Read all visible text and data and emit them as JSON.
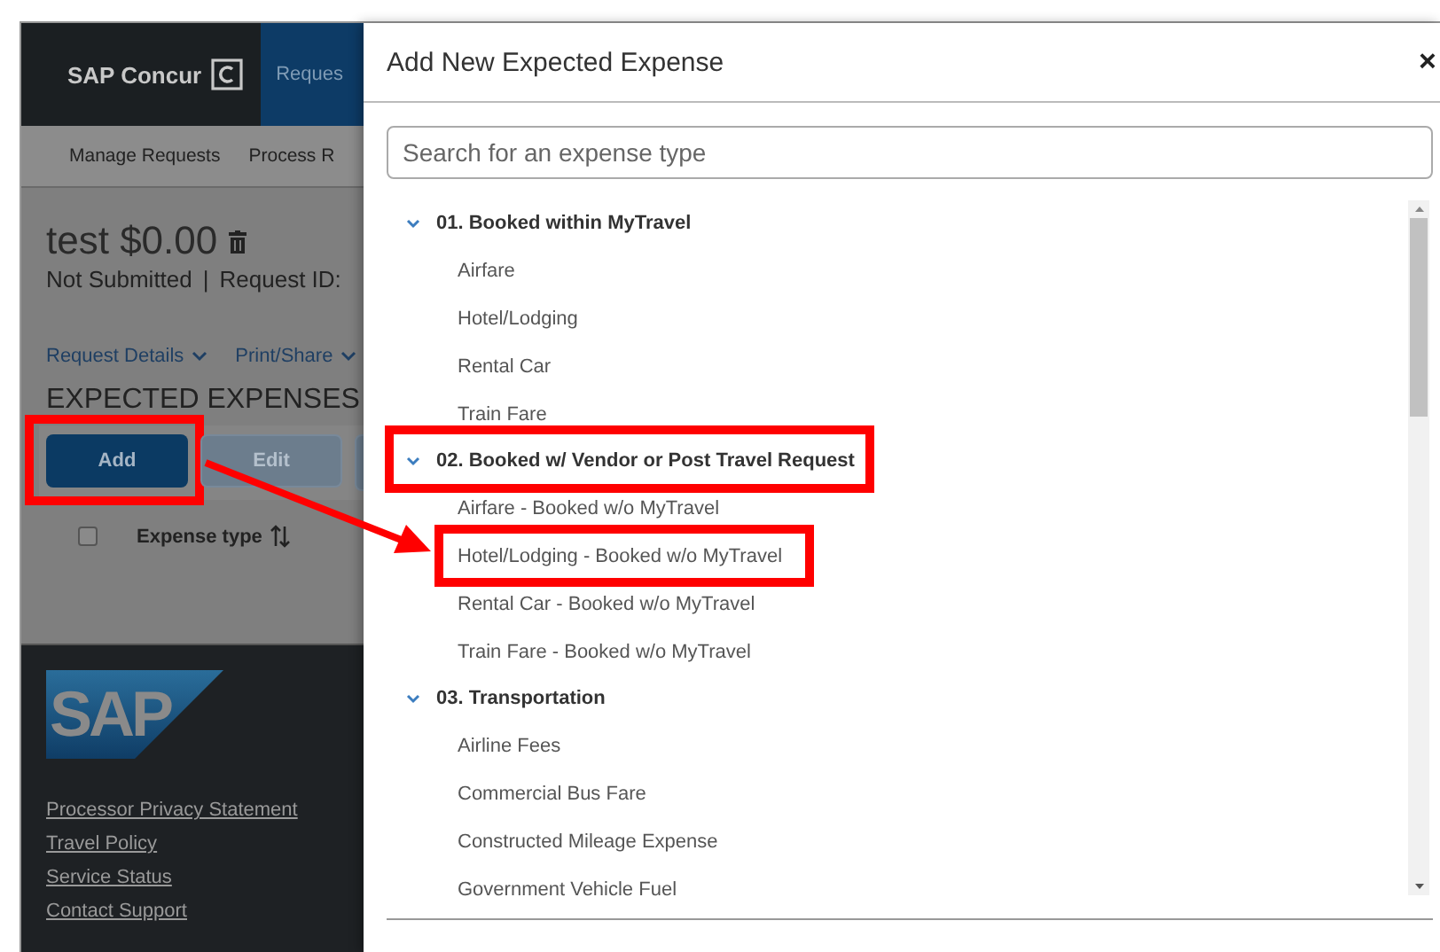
{
  "background_page": {
    "brand": "SAP Concur",
    "nav_tab": "Reques",
    "subnav": [
      "Manage Requests",
      "Process R"
    ],
    "title": "test $0.00",
    "status": "Not Submitted",
    "separator": "|",
    "request_id": "Request ID:",
    "links": [
      "Request Details",
      "Print/Share"
    ],
    "section_title": "EXPECTED EXPENSES",
    "buttons": [
      {
        "label": "Add",
        "disabled": false,
        "highlighted": true
      },
      {
        "label": "Edit",
        "disabled": true,
        "highlighted": false
      }
    ],
    "table_header": {
      "checked": false,
      "column": "Expense type"
    },
    "footer": {
      "logo": "SAP",
      "links": [
        "Processor Privacy Statement",
        "Travel Policy",
        "Service Status",
        "Contact Support"
      ]
    }
  },
  "dialog": {
    "title": "Add New Expected Expense",
    "close": "×",
    "search": {
      "placeholder": "Search for an expense type"
    },
    "groups": [
      {
        "label": "01. Booked within MyTravel",
        "expanded": true,
        "highlighted": false,
        "children": [
          {
            "label": "Airfare",
            "highlighted": false
          },
          {
            "label": "Hotel/Lodging",
            "highlighted": false
          },
          {
            "label": "Rental Car",
            "highlighted": false
          },
          {
            "label": "Train Fare",
            "highlighted": false
          }
        ]
      },
      {
        "label": "02. Booked w/ Vendor or Post Travel Request",
        "expanded": true,
        "highlighted": true,
        "children": [
          {
            "label": "Airfare - Booked w/o MyTravel",
            "highlighted": false
          },
          {
            "label": "Hotel/Lodging - Booked w/o MyTravel",
            "highlighted": true
          },
          {
            "label": "Rental Car - Booked w/o MyTravel",
            "highlighted": false
          },
          {
            "label": "Train Fare - Booked w/o MyTravel",
            "highlighted": false
          }
        ]
      },
      {
        "label": "03. Transportation",
        "expanded": true,
        "highlighted": false,
        "children": [
          {
            "label": "Airline Fees",
            "highlighted": false
          },
          {
            "label": "Commercial Bus Fare",
            "highlighted": false
          },
          {
            "label": "Constructed Mileage Expense",
            "highlighted": false
          },
          {
            "label": "Government Vehicle Fuel",
            "highlighted": false
          }
        ]
      }
    ]
  }
}
